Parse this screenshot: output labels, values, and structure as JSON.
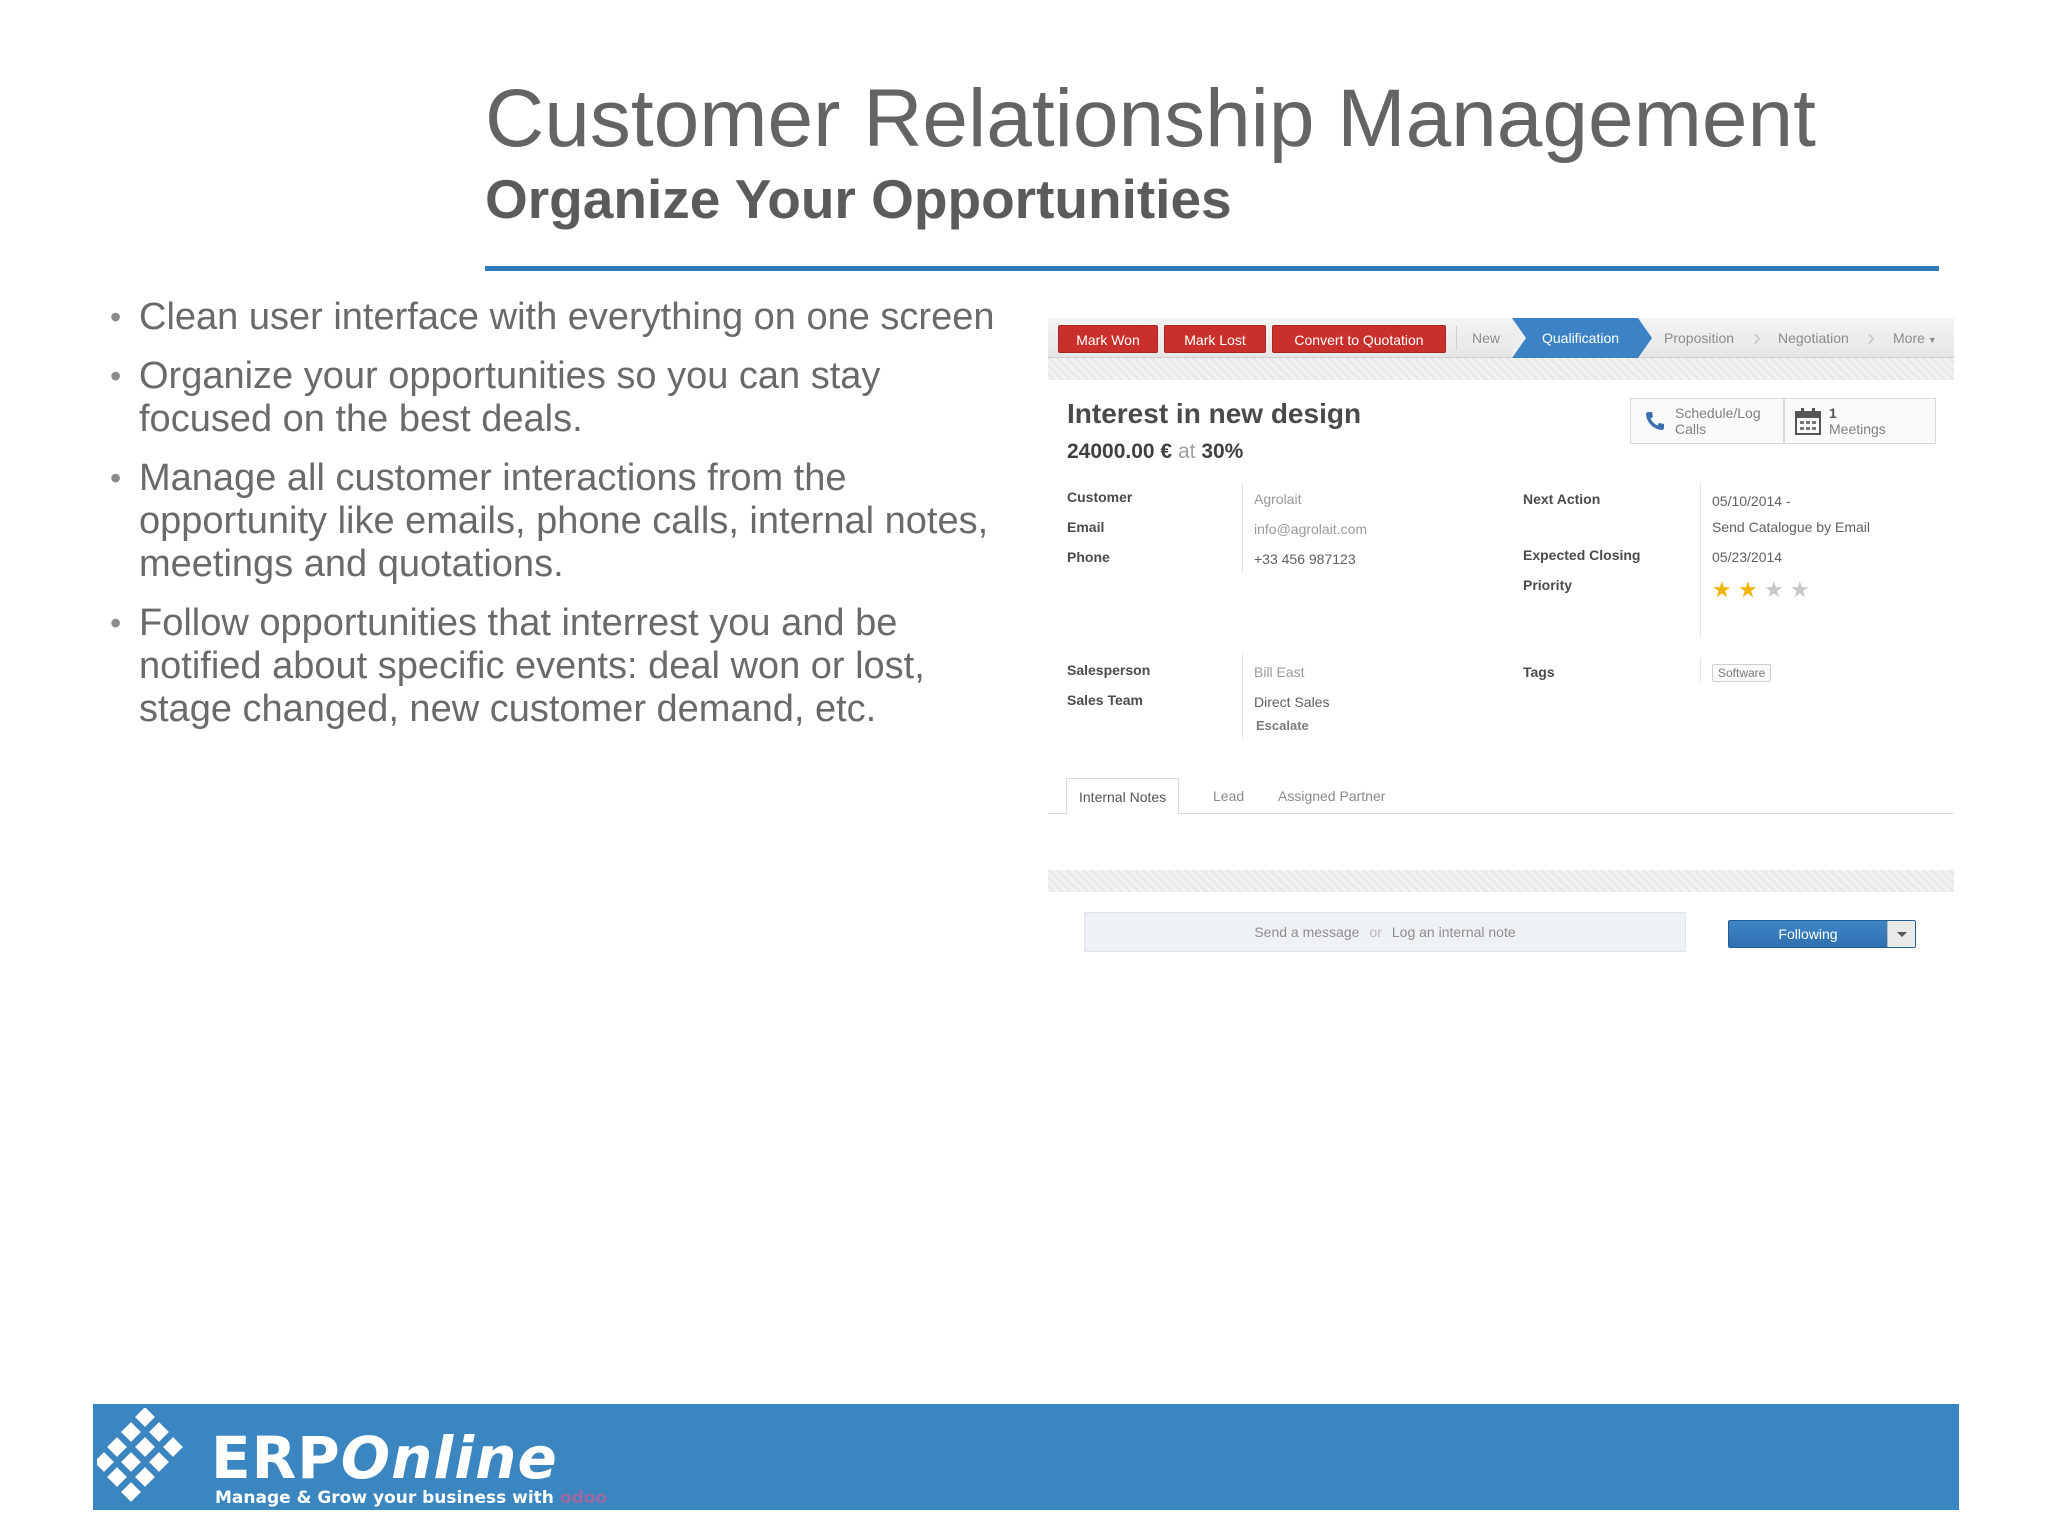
{
  "slide": {
    "title": "Customer Relationship Management",
    "subtitle": "Organize Your Opportunities"
  },
  "bullets": [
    "Clean user interface with everything on one screen",
    "Organize your opportunities so you can stay focused on the best deals.",
    "Manage all customer interactions from the opportunity like emails, phone calls, internal notes, meetings and quotations.",
    "Follow opportunities that interrest you and be notified about specific events: deal won or lost, stage changed, new customer demand, etc."
  ],
  "crm": {
    "buttons": {
      "mark_won": "Mark Won",
      "mark_lost": "Mark Lost",
      "convert": "Convert to Quotation"
    },
    "stages": {
      "new": "New",
      "qualification": "Qualification",
      "proposition": "Proposition",
      "negotiation": "Negotiation",
      "more": "More"
    },
    "smart_buttons": {
      "schedule_line1": "Schedule/Log",
      "schedule_line2": "Calls",
      "meetings_count": "1",
      "meetings_label": "Meetings"
    },
    "record": {
      "name": "Interest in new design",
      "amount": "24000.00 €",
      "at": "at",
      "probability": "30",
      "percent": "%"
    },
    "fields": {
      "customer_label": "Customer",
      "customer_value": "Agrolait",
      "email_label": "Email",
      "email_value": "info@agrolait.com",
      "phone_label": "Phone",
      "phone_value": "+33 456 987123",
      "next_action_label": "Next Action",
      "next_action_date": "05/10/2014",
      "next_action_dash": "-",
      "next_action_text": "Send Catalogue by Email",
      "expected_closing_label": "Expected Closing",
      "expected_closing_value": "05/23/2014",
      "priority_label": "Priority",
      "priority_stars": 2,
      "priority_max": 4,
      "salesperson_label": "Salesperson",
      "salesperson_value": "Bill East",
      "sales_team_label": "Sales Team",
      "sales_team_value": "Direct Sales",
      "escalate": "Escalate",
      "tags_label": "Tags",
      "tag_value": "Software"
    },
    "tabs": {
      "internal_notes": "Internal Notes",
      "lead": "Lead",
      "assigned_partner": "Assigned Partner"
    },
    "chatter": {
      "send_message": "Send a message",
      "or": "or",
      "log_note": "Log an internal note",
      "following": "Following"
    }
  },
  "footer": {
    "brand_a": "ERP",
    "brand_b": "Online",
    "tagline": "Manage & Grow your business with",
    "odoo": "odoo"
  },
  "colors": {
    "accent_blue": "#3b86c0",
    "button_red": "#c9302c",
    "stage_active": "#3b83c4",
    "star_on": "#f0b400",
    "star_off": "#c8c8c8"
  }
}
